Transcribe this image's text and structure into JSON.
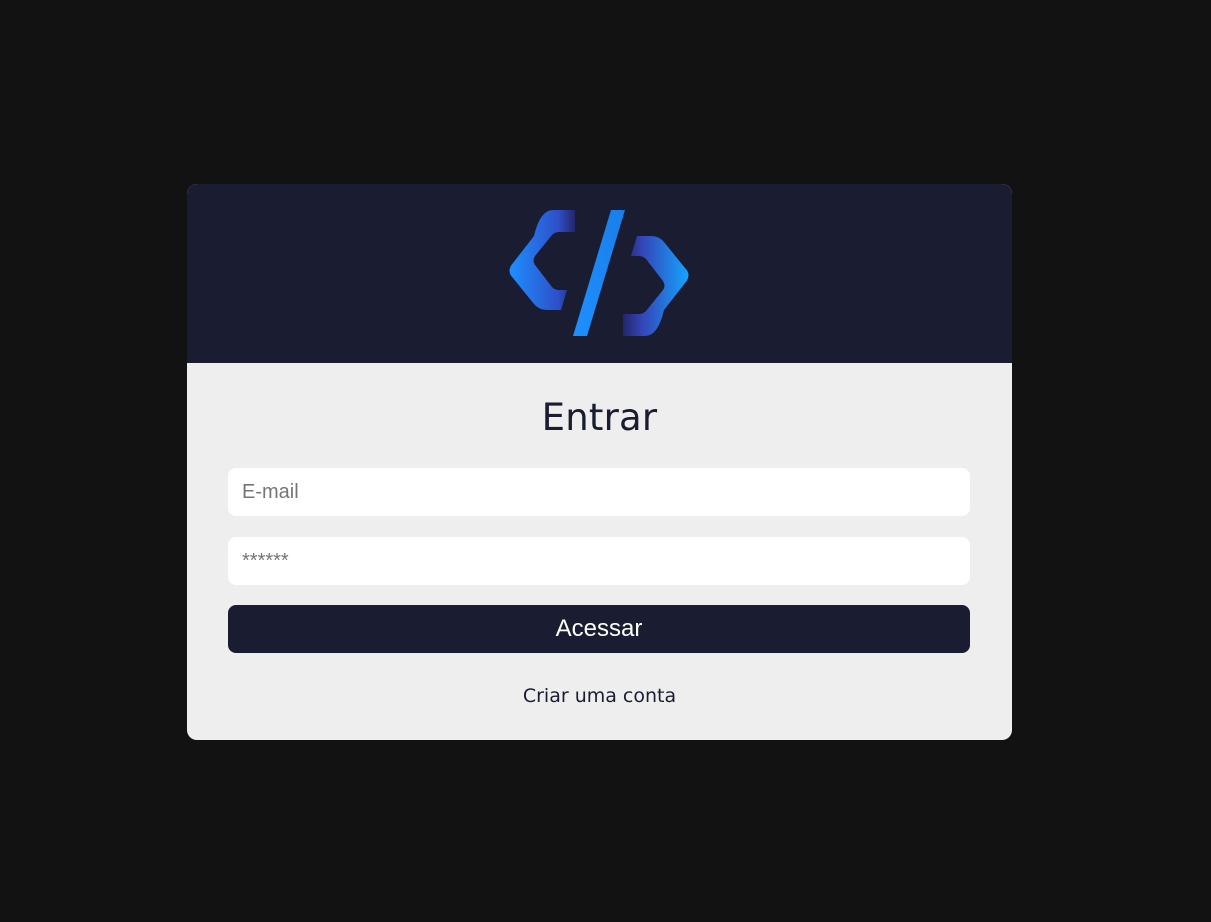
{
  "colors": {
    "page_background": "#121212",
    "header_background": "#1a1d31",
    "card_background": "#efeeee",
    "accent_blue": "#1e90ff",
    "accent_indigo": "#3a3f9e"
  },
  "header": {
    "logo_icon": "code-brackets-logo-icon"
  },
  "login": {
    "title": "Entrar",
    "email_placeholder": "E-mail",
    "email_value": "",
    "password_placeholder": "******",
    "password_value": "",
    "submit_label": "Acessar",
    "create_account_label": "Criar uma conta"
  }
}
